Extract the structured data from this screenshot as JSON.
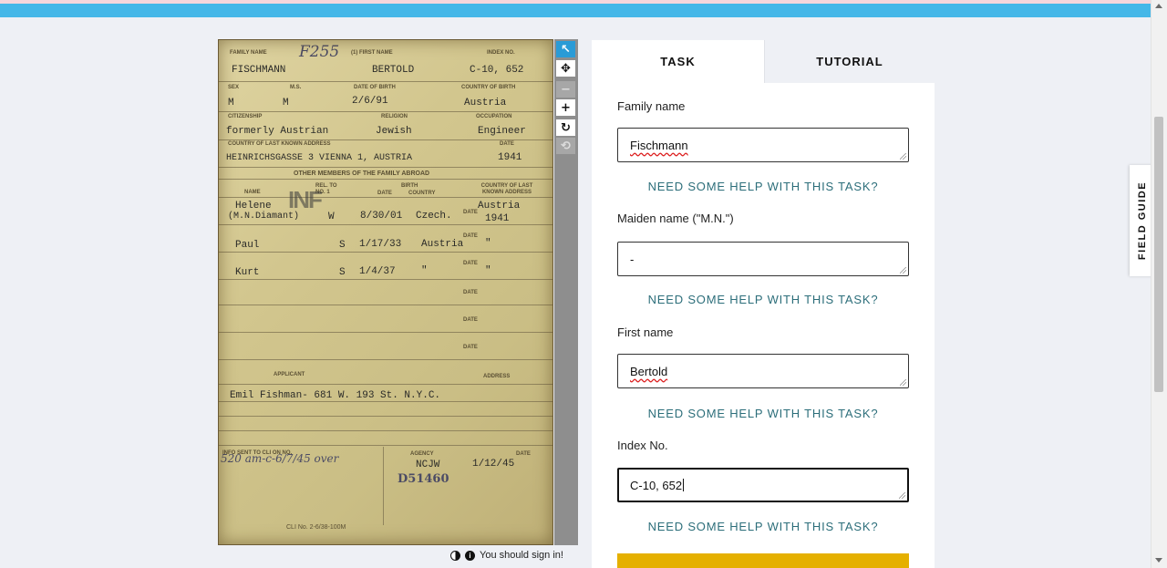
{
  "card": {
    "labels": {
      "family_name": "FAMILY NAME",
      "first_name": "(1) FIRST NAME",
      "index_no": "INDEX NO.",
      "sex": "SEX",
      "ms": "M.S.",
      "date_of_birth": "DATE OF BIRTH",
      "country_of_birth": "COUNTRY OF BIRTH",
      "citizenship": "CITIZENSHIP",
      "religion": "RELIGION",
      "occupation": "OCCUPATION",
      "country_last_address": "COUNTRY OF LAST KNOWN ADDRESS",
      "date": "DATE",
      "other_members": "OTHER MEMBERS OF THE FAMILY ABROAD",
      "name": "NAME",
      "rel_to": "REL. TO NO. 1",
      "birth_date": "DATE",
      "birth_country": "COUNTRY",
      "birth": "BIRTH",
      "country_last": "COUNTRY OF LAST KNOWN ADDRESS",
      "applicant": "APPLICANT",
      "address": "ADDRESS",
      "cli_sent": "INFO SENT TO CLI ON NO.",
      "agency": "AGENCY",
      "agency_date": "DATE",
      "footer": "CLI No. 2-6/38-100M"
    },
    "values": {
      "handwritten_code": "F255",
      "family_name": "FISCHMANN",
      "first_name": "BERTOLD",
      "index_no": "C-10, 652",
      "sex": "M",
      "ms": "M",
      "dob": "2/6/91",
      "country_of_birth": "Austria",
      "citizenship": "formerly Austrian",
      "religion": "Jewish",
      "occupation": "Engineer",
      "last_address": "HEINRICHSGASSE 3 VIENNA 1, AUSTRIA",
      "last_date": "1941",
      "m1_name": "Helene",
      "m1_maiden": "(M.N.Diamant)",
      "m1_rel": "W",
      "m1_date": "8/30/01",
      "m1_country": "Czech.",
      "m1_last": "Austria",
      "m1_last_date": "1941",
      "m2_name": "Paul",
      "m2_rel": "S",
      "m2_date": "1/17/33",
      "m2_country": "Austria",
      "m2_ditto": "\"",
      "m3_name": "Kurt",
      "m3_rel": "S",
      "m3_date": "1/4/37",
      "m3_ditto1": "\"",
      "m3_ditto2": "\"",
      "stamp": "INF",
      "applicant": "Emil Fishman- 681 W. 193 St. N.Y.C.",
      "cli_hand": "520 am-c-6/7/45 over",
      "agency_name": "NCJW",
      "agency_date": "1/12/45",
      "agency_code": "D51460"
    }
  },
  "toolbar": {
    "tools": [
      {
        "name": "pointer-tool",
        "glyph": "↖"
      },
      {
        "name": "move-tool",
        "glyph": "✥"
      },
      {
        "name": "zoom-out-tool",
        "glyph": "−"
      },
      {
        "name": "zoom-in-tool",
        "glyph": "+"
      },
      {
        "name": "rotate-tool",
        "glyph": "↻"
      },
      {
        "name": "reset-tool",
        "glyph": "⟲"
      }
    ]
  },
  "signin": {
    "text": "You should sign in!"
  },
  "tabs": {
    "task": "TASK",
    "tutorial": "TUTORIAL"
  },
  "fields": {
    "family_name": {
      "label": "Family name",
      "value": "Fischmann"
    },
    "maiden_name": {
      "label": "Maiden name (\"M.N.\")",
      "value": "-"
    },
    "first_name": {
      "label": "First name",
      "value": "Bertold"
    },
    "index_no": {
      "label": "Index No.",
      "value": "C-10, 652"
    }
  },
  "help_text": "NEED SOME HELP WITH THIS TASK?",
  "field_guide": "FIELD GUIDE",
  "colors": {
    "accent_bar": "#45b7e8",
    "help_link": "#2c6e7a",
    "done_button": "#e5b000"
  }
}
